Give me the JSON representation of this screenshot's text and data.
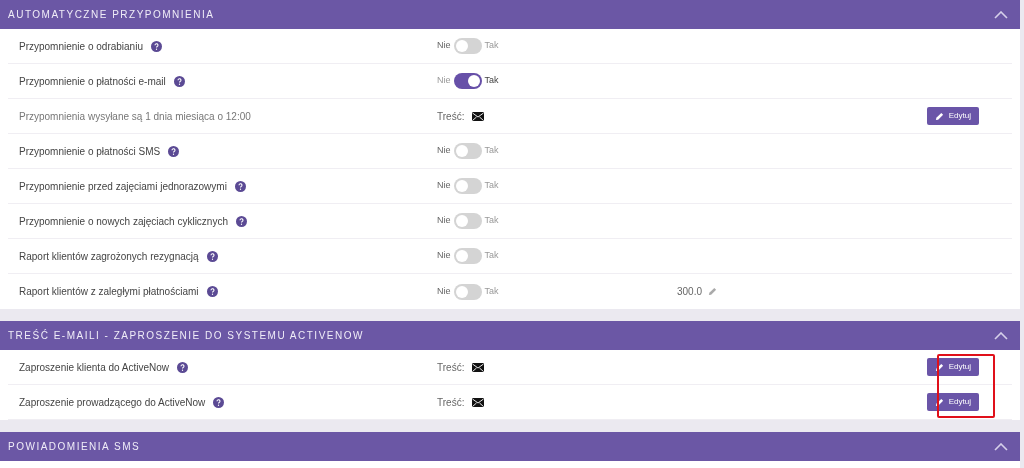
{
  "sections": [
    {
      "title": "AUTOMATYCZNE PRZYPOMNIENIA",
      "rows": [
        {
          "kind": "toggle",
          "label": "Przypomnienie o odrabianiu",
          "help": true,
          "off_label": "Nie",
          "on_label": "Tak",
          "on": false
        },
        {
          "kind": "toggle",
          "label": "Przypomnienie o płatności e-mail",
          "help": true,
          "off_label": "Nie",
          "on_label": "Tak",
          "on": true
        },
        {
          "kind": "content",
          "label": "Przypomnienia wysyłane są 1 dnia miesiąca o 12:00",
          "help": false,
          "muted": true,
          "content_label": "Treść:",
          "button": "Edytuj"
        },
        {
          "kind": "toggle",
          "label": "Przypomnienie o płatności SMS",
          "help": true,
          "off_label": "Nie",
          "on_label": "Tak",
          "on": false
        },
        {
          "kind": "toggle",
          "label": "Przypomnienie przed zajęciami jednorazowymi",
          "help": true,
          "off_label": "Nie",
          "on_label": "Tak",
          "on": false
        },
        {
          "kind": "toggle",
          "label": "Przypomnienie o nowych zajęciach cyklicznych",
          "help": true,
          "off_label": "Nie",
          "on_label": "Tak",
          "on": false
        },
        {
          "kind": "toggle",
          "label": "Raport klientów zagrożonych rezygnacją",
          "help": true,
          "off_label": "Nie",
          "on_label": "Tak",
          "on": false
        },
        {
          "kind": "toggle",
          "label": "Raport klientów z zaległymi płatnościami",
          "help": true,
          "off_label": "Nie",
          "on_label": "Tak",
          "on": false,
          "amount": "300.0"
        }
      ]
    },
    {
      "title": "TREŚĆ E-MAILI - ZAPROSZENIE DO SYSTEMU ACTIVENOW",
      "highlight_buttons": true,
      "rows": [
        {
          "kind": "content",
          "label": "Zaproszenie klienta do ActiveNow",
          "help": true,
          "content_label": "Treść:",
          "button": "Edytuj"
        },
        {
          "kind": "content",
          "label": "Zaproszenie prowadzącego do ActiveNow",
          "help": true,
          "content_label": "Treść:",
          "button": "Edytuj"
        }
      ]
    },
    {
      "title": "POWIADOMIENIA SMS"
    }
  ]
}
